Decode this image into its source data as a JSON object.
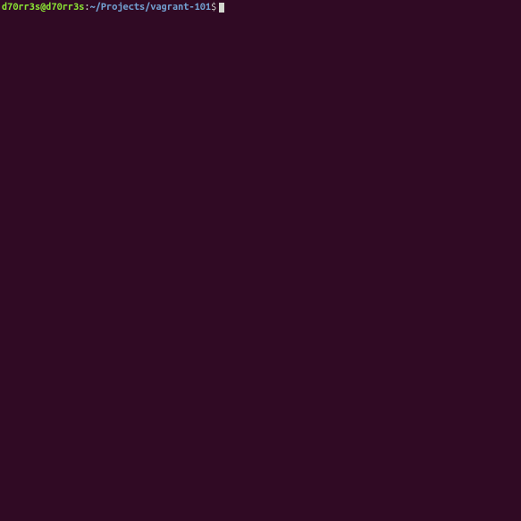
{
  "prompt": {
    "user_host": "d70rr3s@d70rr3s",
    "separator": ":",
    "path": "~/Projects/vagrant-101",
    "symbol": "$",
    "input": ""
  }
}
